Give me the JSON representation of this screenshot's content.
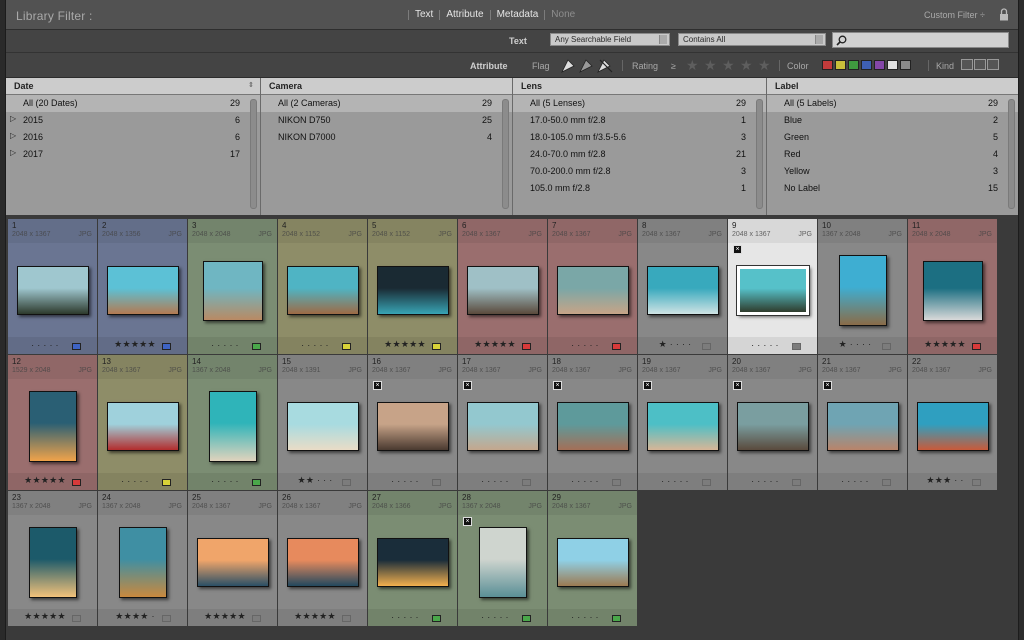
{
  "filter_bar": {
    "title": "Library Filter :",
    "modes": [
      {
        "label": "Text",
        "active": true
      },
      {
        "label": "Attribute",
        "active": true
      },
      {
        "label": "Metadata",
        "active": true
      },
      {
        "label": "None",
        "active": false
      }
    ],
    "preset": "Custom Filter ÷"
  },
  "text_filter": {
    "label": "Text",
    "field": "Any Searchable Field",
    "rule": "Contains All",
    "query": ""
  },
  "attribute_filter": {
    "label": "Attribute",
    "flag_label": "Flag",
    "rating_label": "Rating",
    "rating_op": "≥",
    "color_label": "Color",
    "kind_label": "Kind",
    "swatches": [
      "#c23b3b",
      "#c7c03a",
      "#3f9a3f",
      "#3e5fb3",
      "#8447a8",
      "#e0e0e0",
      "#8a8a8a"
    ]
  },
  "columns": [
    {
      "title": "Date",
      "rows": [
        {
          "label": "All (20 Dates)",
          "count": "29",
          "selected": true,
          "expand": ""
        },
        {
          "label": "2015",
          "count": "6",
          "selected": false,
          "expand": "▷"
        },
        {
          "label": "2016",
          "count": "6",
          "selected": false,
          "expand": "▷"
        },
        {
          "label": "2017",
          "count": "17",
          "selected": false,
          "expand": "▷"
        }
      ]
    },
    {
      "title": "Camera",
      "rows": [
        {
          "label": "All (2 Cameras)",
          "count": "29",
          "selected": true,
          "expand": ""
        },
        {
          "label": "NIKON D750",
          "count": "25",
          "selected": false,
          "expand": ""
        },
        {
          "label": "NIKON D7000",
          "count": "4",
          "selected": false,
          "expand": ""
        }
      ]
    },
    {
      "title": "Lens",
      "rows": [
        {
          "label": "All (5 Lenses)",
          "count": "29",
          "selected": true,
          "expand": ""
        },
        {
          "label": "17.0-50.0 mm f/2.8",
          "count": "1",
          "selected": false,
          "expand": ""
        },
        {
          "label": "18.0-105.0 mm f/3.5-5.6",
          "count": "3",
          "selected": false,
          "expand": ""
        },
        {
          "label": "24.0-70.0 mm f/2.8",
          "count": "21",
          "selected": false,
          "expand": ""
        },
        {
          "label": "70.0-200.0 mm f/2.8",
          "count": "3",
          "selected": false,
          "expand": ""
        },
        {
          "label": "105.0 mm f/2.8",
          "count": "1",
          "selected": false,
          "expand": ""
        }
      ]
    },
    {
      "title": "Label",
      "rows": [
        {
          "label": "All (5 Labels)",
          "count": "29",
          "selected": true,
          "expand": ""
        },
        {
          "label": "Blue",
          "count": "2",
          "selected": false,
          "expand": ""
        },
        {
          "label": "Green",
          "count": "5",
          "selected": false,
          "expand": ""
        },
        {
          "label": "Red",
          "count": "4",
          "selected": false,
          "expand": ""
        },
        {
          "label": "Yellow",
          "count": "3",
          "selected": false,
          "expand": ""
        },
        {
          "label": "No Label",
          "count": "15",
          "selected": false,
          "expand": ""
        }
      ]
    }
  ],
  "label_colors": {
    "blue": "#3e63c4",
    "green": "#4aa84a",
    "yellow": "#d8d238",
    "red": "#d83a3a"
  },
  "photos": [
    {
      "num": "1",
      "dims": "2048 x 1367",
      "ext": "JPG",
      "stars": "· · · · ·",
      "label": "blue",
      "flag": false,
      "orient": "land",
      "colors": [
        "#9fc7cf",
        "#2d3a2c"
      ]
    },
    {
      "num": "2",
      "dims": "2048 x 1356",
      "ext": "JPG",
      "stars": "★★★★★",
      "label": "blue",
      "flag": false,
      "orient": "land",
      "colors": [
        "#5cc1d6",
        "#b47a52"
      ]
    },
    {
      "num": "3",
      "dims": "2048 x 2048",
      "ext": "JPG",
      "stars": "· · · · ·",
      "label": "green",
      "flag": false,
      "orient": "square",
      "colors": [
        "#6fb6c2",
        "#b98a63"
      ]
    },
    {
      "num": "4",
      "dims": "2048 x 1152",
      "ext": "JPG",
      "stars": "· · · · ·",
      "label": "yellow",
      "flag": false,
      "orient": "land",
      "colors": [
        "#4fb4c4",
        "#9e6a45"
      ]
    },
    {
      "num": "5",
      "dims": "2048 x 1152",
      "ext": "JPG",
      "stars": "★★★★★",
      "label": "yellow",
      "flag": false,
      "orient": "land",
      "colors": [
        "#1a2a33",
        "#38a4b4"
      ]
    },
    {
      "num": "6",
      "dims": "2048 x 1367",
      "ext": "JPG",
      "stars": "★★★★★",
      "label": "red",
      "flag": false,
      "orient": "land",
      "colors": [
        "#9fc0c6",
        "#5a4a3c"
      ]
    },
    {
      "num": "7",
      "dims": "2048 x 1367",
      "ext": "JPG",
      "stars": "· · · · ·",
      "label": "red",
      "flag": false,
      "orient": "land",
      "colors": [
        "#7aa7a7",
        "#c7a487"
      ]
    },
    {
      "num": "8",
      "dims": "2048 x 1367",
      "ext": "JPG",
      "stars": "★ · · · ·",
      "label": "none",
      "flag": false,
      "orient": "land",
      "colors": [
        "#38a9bd",
        "#cfe3e4"
      ]
    },
    {
      "num": "9",
      "dims": "2048 x 1367",
      "ext": "JPG",
      "stars": "· · · · ·",
      "label": "none",
      "flag": true,
      "orient": "land",
      "colors": [
        "#56c1c9",
        "#2f3c2c"
      ]
    },
    {
      "num": "10",
      "dims": "1367 x 2048",
      "ext": "JPG",
      "stars": "★ · · · ·",
      "label": "none",
      "flag": false,
      "orient": "port",
      "colors": [
        "#3eaed2",
        "#8a6c48"
      ]
    },
    {
      "num": "11",
      "dims": "2048 x 2048",
      "ext": "JPG",
      "stars": "★★★★★",
      "label": "red",
      "flag": false,
      "orient": "square",
      "colors": [
        "#1c6f82",
        "#d9d9d9"
      ]
    },
    {
      "num": "12",
      "dims": "1529 x 2048",
      "ext": "JPG",
      "stars": "★★★★★",
      "label": "red",
      "flag": false,
      "orient": "port",
      "colors": [
        "#2a5f74",
        "#f0a34a"
      ]
    },
    {
      "num": "13",
      "dims": "2048 x 1367",
      "ext": "JPG",
      "stars": "· · · · ·",
      "label": "yellow",
      "flag": false,
      "orient": "land",
      "colors": [
        "#9fd1dc",
        "#b32d2d"
      ]
    },
    {
      "num": "14",
      "dims": "1367 x 2048",
      "ext": "JPG",
      "stars": "· · · · ·",
      "label": "green",
      "flag": false,
      "orient": "port",
      "colors": [
        "#2fb4b9",
        "#e0d3bd"
      ]
    },
    {
      "num": "15",
      "dims": "2048 x 1391",
      "ext": "JPG",
      "stars": "★★ · · ·",
      "label": "none",
      "flag": false,
      "orient": "land",
      "colors": [
        "#a8dbe0",
        "#e9dcc7"
      ]
    },
    {
      "num": "16",
      "dims": "2048 x 1367",
      "ext": "JPG",
      "stars": "· · · · ·",
      "label": "none",
      "flag": true,
      "orient": "land",
      "colors": [
        "#c7a388",
        "#4a3a30"
      ]
    },
    {
      "num": "17",
      "dims": "2048 x 1367",
      "ext": "JPG",
      "stars": "· · · · ·",
      "label": "none",
      "flag": true,
      "orient": "land",
      "colors": [
        "#93c8cf",
        "#c4a78d"
      ]
    },
    {
      "num": "18",
      "dims": "2048 x 1367",
      "ext": "JPG",
      "stars": "· · · · ·",
      "label": "none",
      "flag": true,
      "orient": "land",
      "colors": [
        "#5e9a9b",
        "#a46f57"
      ]
    },
    {
      "num": "19",
      "dims": "2048 x 1367",
      "ext": "JPG",
      "stars": "· · · · ·",
      "label": "none",
      "flag": true,
      "orient": "land",
      "colors": [
        "#4dbfc6",
        "#d7b697"
      ]
    },
    {
      "num": "20",
      "dims": "2048 x 1367",
      "ext": "JPG",
      "stars": "· · · · ·",
      "label": "none",
      "flag": true,
      "orient": "land",
      "colors": [
        "#7a9ea0",
        "#5a4a3d"
      ]
    },
    {
      "num": "21",
      "dims": "2048 x 1367",
      "ext": "JPG",
      "stars": "· · · · ·",
      "label": "none",
      "flag": true,
      "orient": "land",
      "colors": [
        "#6fa4b3",
        "#b9846a"
      ]
    },
    {
      "num": "22",
      "dims": "2048 x 1367",
      "ext": "JPG",
      "stars": "★★★ · ·",
      "label": "none",
      "flag": false,
      "orient": "land",
      "colors": [
        "#2f9fc0",
        "#c95a3a"
      ]
    },
    {
      "num": "23",
      "dims": "1367 x 2048",
      "ext": "JPG",
      "stars": "★★★★★",
      "label": "none",
      "flag": false,
      "orient": "port",
      "colors": [
        "#1c5a6a",
        "#f2c27a"
      ]
    },
    {
      "num": "24",
      "dims": "1367 x 2048",
      "ext": "JPG",
      "stars": "★★★★ ·",
      "label": "none",
      "flag": false,
      "orient": "port",
      "colors": [
        "#3f8fa3",
        "#c9893e"
      ]
    },
    {
      "num": "25",
      "dims": "2048 x 1367",
      "ext": "JPG",
      "stars": "★★★★★",
      "label": "none",
      "flag": false,
      "orient": "land",
      "colors": [
        "#f0a56a",
        "#2a4f66"
      ]
    },
    {
      "num": "26",
      "dims": "2048 x 1367",
      "ext": "JPG",
      "stars": "★★★★★",
      "label": "none",
      "flag": false,
      "orient": "land",
      "colors": [
        "#e78a5d",
        "#22485e"
      ]
    },
    {
      "num": "27",
      "dims": "2048 x 1366",
      "ext": "JPG",
      "stars": "· · · · ·",
      "label": "green",
      "flag": false,
      "orient": "land",
      "colors": [
        "#1a2d3a",
        "#f3b04e"
      ]
    },
    {
      "num": "28",
      "dims": "1367 x 2048",
      "ext": "JPG",
      "stars": "· · · · ·",
      "label": "green",
      "flag": true,
      "orient": "port",
      "colors": [
        "#cfd5cf",
        "#5a8f96"
      ]
    },
    {
      "num": "29",
      "dims": "2048 x 1367",
      "ext": "JPG",
      "stars": "· · · · ·",
      "label": "green",
      "flag": false,
      "orient": "land",
      "colors": [
        "#8fd0e6",
        "#9c7a52"
      ]
    }
  ]
}
